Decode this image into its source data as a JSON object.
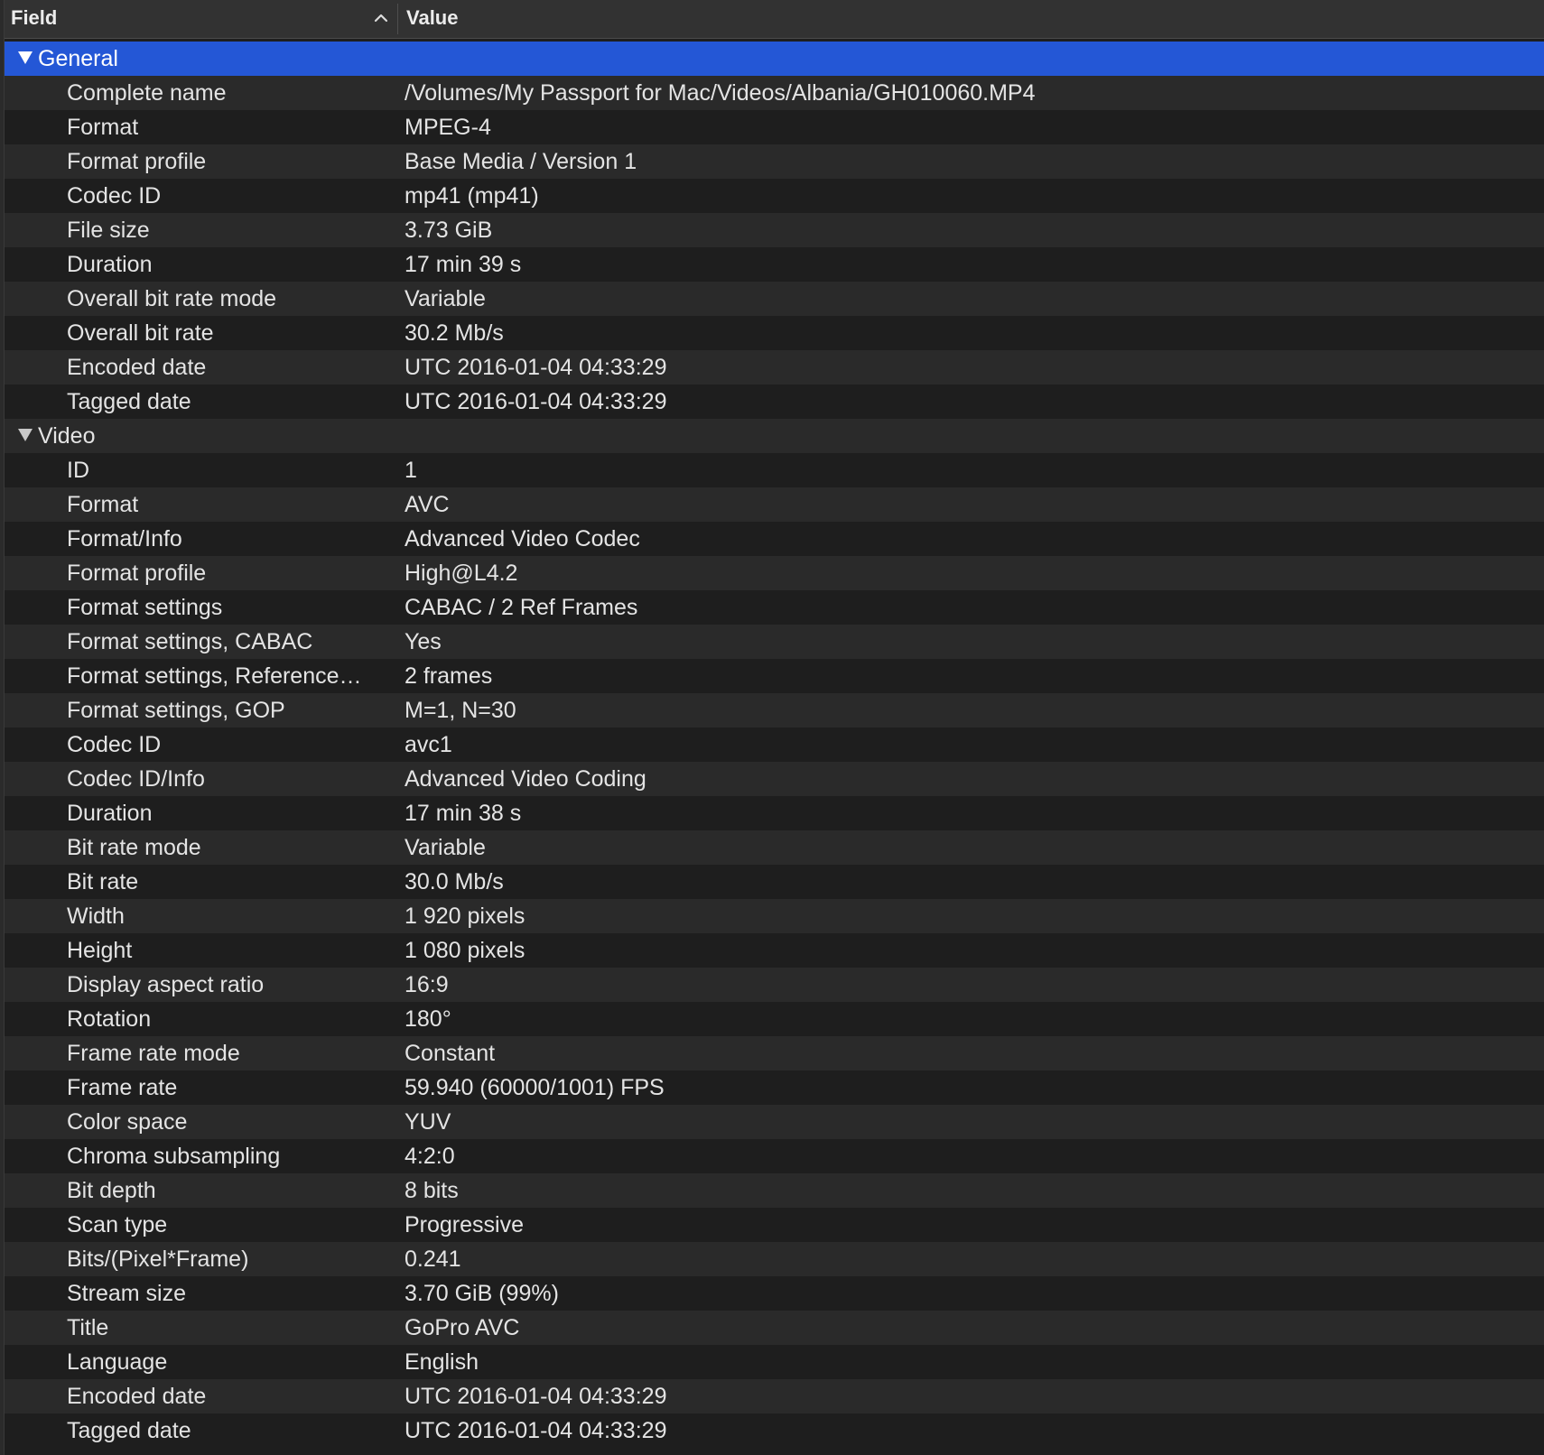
{
  "header": {
    "field_label": "Field",
    "value_label": "Value",
    "sort_icon": "chevron-up-icon"
  },
  "colors": {
    "selected_row": "#2457d6",
    "header_bg": "#323232",
    "row_dark": "#1e1e1e",
    "row_light": "#2a2a2a"
  },
  "sections": [
    {
      "label": "General",
      "selected": true,
      "expanded": true,
      "rows": [
        {
          "field": "Complete name",
          "value": "/Volumes/My Passport for Mac/Videos/Albania/GH010060.MP4"
        },
        {
          "field": "Format",
          "value": "MPEG-4"
        },
        {
          "field": "Format profile",
          "value": "Base Media / Version 1"
        },
        {
          "field": "Codec ID",
          "value": "mp41 (mp41)"
        },
        {
          "field": "File size",
          "value": "3.73 GiB"
        },
        {
          "field": "Duration",
          "value": "17 min 39 s"
        },
        {
          "field": "Overall bit rate mode",
          "value": "Variable"
        },
        {
          "field": "Overall bit rate",
          "value": "30.2 Mb/s"
        },
        {
          "field": "Encoded date",
          "value": "UTC 2016-01-04 04:33:29"
        },
        {
          "field": "Tagged date",
          "value": "UTC 2016-01-04 04:33:29"
        }
      ]
    },
    {
      "label": "Video",
      "selected": false,
      "expanded": true,
      "rows": [
        {
          "field": "ID",
          "value": "1"
        },
        {
          "field": "Format",
          "value": "AVC"
        },
        {
          "field": "Format/Info",
          "value": "Advanced Video Codec"
        },
        {
          "field": "Format profile",
          "value": "High@L4.2"
        },
        {
          "field": "Format settings",
          "value": "CABAC / 2 Ref Frames"
        },
        {
          "field": "Format settings, CABAC",
          "value": "Yes"
        },
        {
          "field": "Format settings, Reference…",
          "value": "2 frames"
        },
        {
          "field": "Format settings, GOP",
          "value": "M=1, N=30"
        },
        {
          "field": "Codec ID",
          "value": "avc1"
        },
        {
          "field": "Codec ID/Info",
          "value": "Advanced Video Coding"
        },
        {
          "field": "Duration",
          "value": "17 min 38 s"
        },
        {
          "field": "Bit rate mode",
          "value": "Variable"
        },
        {
          "field": "Bit rate",
          "value": "30.0 Mb/s"
        },
        {
          "field": "Width",
          "value": "1 920 pixels"
        },
        {
          "field": "Height",
          "value": "1 080 pixels"
        },
        {
          "field": "Display aspect ratio",
          "value": "16:9"
        },
        {
          "field": "Rotation",
          "value": "180°"
        },
        {
          "field": "Frame rate mode",
          "value": "Constant"
        },
        {
          "field": "Frame rate",
          "value": "59.940 (60000/1001) FPS"
        },
        {
          "field": "Color space",
          "value": "YUV"
        },
        {
          "field": "Chroma subsampling",
          "value": "4:2:0"
        },
        {
          "field": "Bit depth",
          "value": "8 bits"
        },
        {
          "field": "Scan type",
          "value": "Progressive"
        },
        {
          "field": "Bits/(Pixel*Frame)",
          "value": "0.241"
        },
        {
          "field": "Stream size",
          "value": "3.70 GiB (99%)"
        },
        {
          "field": "Title",
          "value": "GoPro AVC"
        },
        {
          "field": "Language",
          "value": "English"
        },
        {
          "field": "Encoded date",
          "value": "UTC 2016-01-04 04:33:29"
        },
        {
          "field": "Tagged date",
          "value": "UTC 2016-01-04 04:33:29"
        }
      ]
    }
  ]
}
